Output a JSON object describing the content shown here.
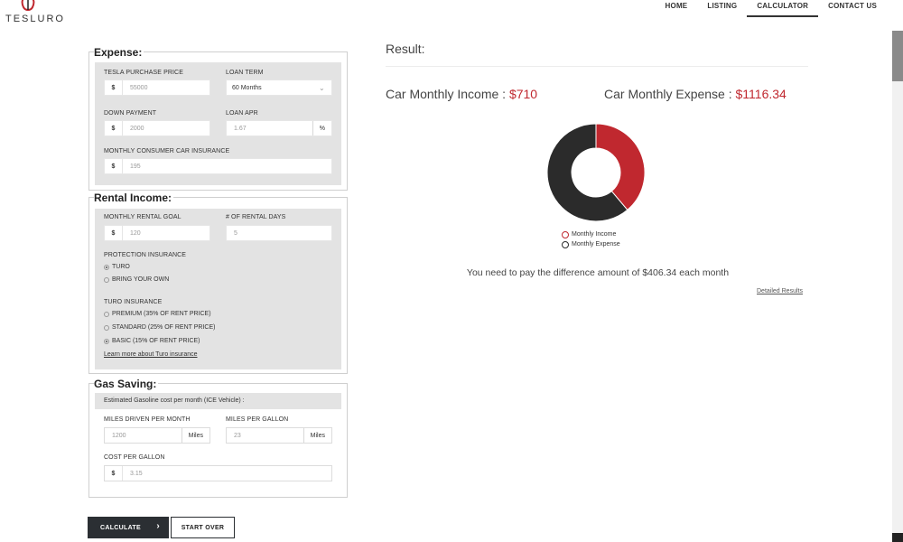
{
  "brand": {
    "name": "TESLURO",
    "accent": "#c0282f"
  },
  "nav": {
    "items": [
      {
        "label": "HOME"
      },
      {
        "label": "LISTING"
      },
      {
        "label": "CALCULATOR",
        "active": true
      },
      {
        "label": "CONTACT US"
      }
    ]
  },
  "expense": {
    "title": "Expense:",
    "purchase_price_label": "TESLA PURCHASE PRICE",
    "purchase_price_prefix": "$",
    "purchase_price_value": "55000",
    "loan_term_label": "LOAN TERM",
    "loan_term_value": "60 Months",
    "down_payment_label": "DOWN PAYMENT",
    "down_payment_prefix": "$",
    "down_payment_value": "2000",
    "loan_apr_label": "LOAN APR",
    "loan_apr_value": "1.67",
    "loan_apr_suffix": "%",
    "insurance_label": "MONTHLY CONSUMER CAR INSURANCE",
    "insurance_prefix": "$",
    "insurance_value": "195"
  },
  "rental": {
    "title": "Rental Income:",
    "goal_label": "MONTHLY RENTAL GOAL",
    "goal_prefix": "$",
    "goal_value": "120",
    "days_label": "# OF RENTAL DAYS",
    "days_value": "5",
    "protection_label": "PROTECTION INSURANCE",
    "protection_options": [
      {
        "label": "TURO",
        "selected": true
      },
      {
        "label": "BRING YOUR OWN",
        "selected": false
      }
    ],
    "turo_label": "TURO INSURANCE",
    "turo_options": [
      {
        "label": "PREMIUM (35% OF RENT PRICE)",
        "selected": false
      },
      {
        "label": "STANDARD (25% OF RENT PRICE)",
        "selected": false
      },
      {
        "label": "BASIC (15% OF RENT PRICE)",
        "selected": true
      }
    ],
    "learn_more": "Learn more about Turo insurance"
  },
  "gas": {
    "title": "Gas Saving:",
    "note": "Estimated Gasoline cost per month (ICE Vehicle) :",
    "miles_label": "MILES DRIVEN PER MONTH",
    "miles_value": "1200",
    "miles_suffix": "Miles",
    "mpg_label": "MILES PER GALLON",
    "mpg_value": "23",
    "mpg_suffix": "Miles",
    "cost_label": "COST PER GALLON",
    "cost_prefix": "$",
    "cost_value": "3.15"
  },
  "buttons": {
    "calculate": "CALCULATE",
    "start_over": "START OVER"
  },
  "result": {
    "title": "Result:",
    "income_label": "Car Monthly Income : ",
    "income_value": "$710",
    "expense_label": "Car Monthly Expense : ",
    "expense_value": "$1116.34",
    "legend_income": "Monthly Income",
    "legend_expense": "Monthly Expense",
    "income_color": "#c0282f",
    "expense_color": "#2b2b2b",
    "difference_text": "You need to pay the difference amount of $406.34 each month",
    "detail_link": "Detailed Results"
  },
  "chart_data": {
    "type": "pie",
    "categories": [
      "Monthly Income",
      "Monthly Expense"
    ],
    "values": [
      710,
      1116.34
    ],
    "colors": [
      "#c0282f",
      "#2b2b2b"
    ]
  }
}
